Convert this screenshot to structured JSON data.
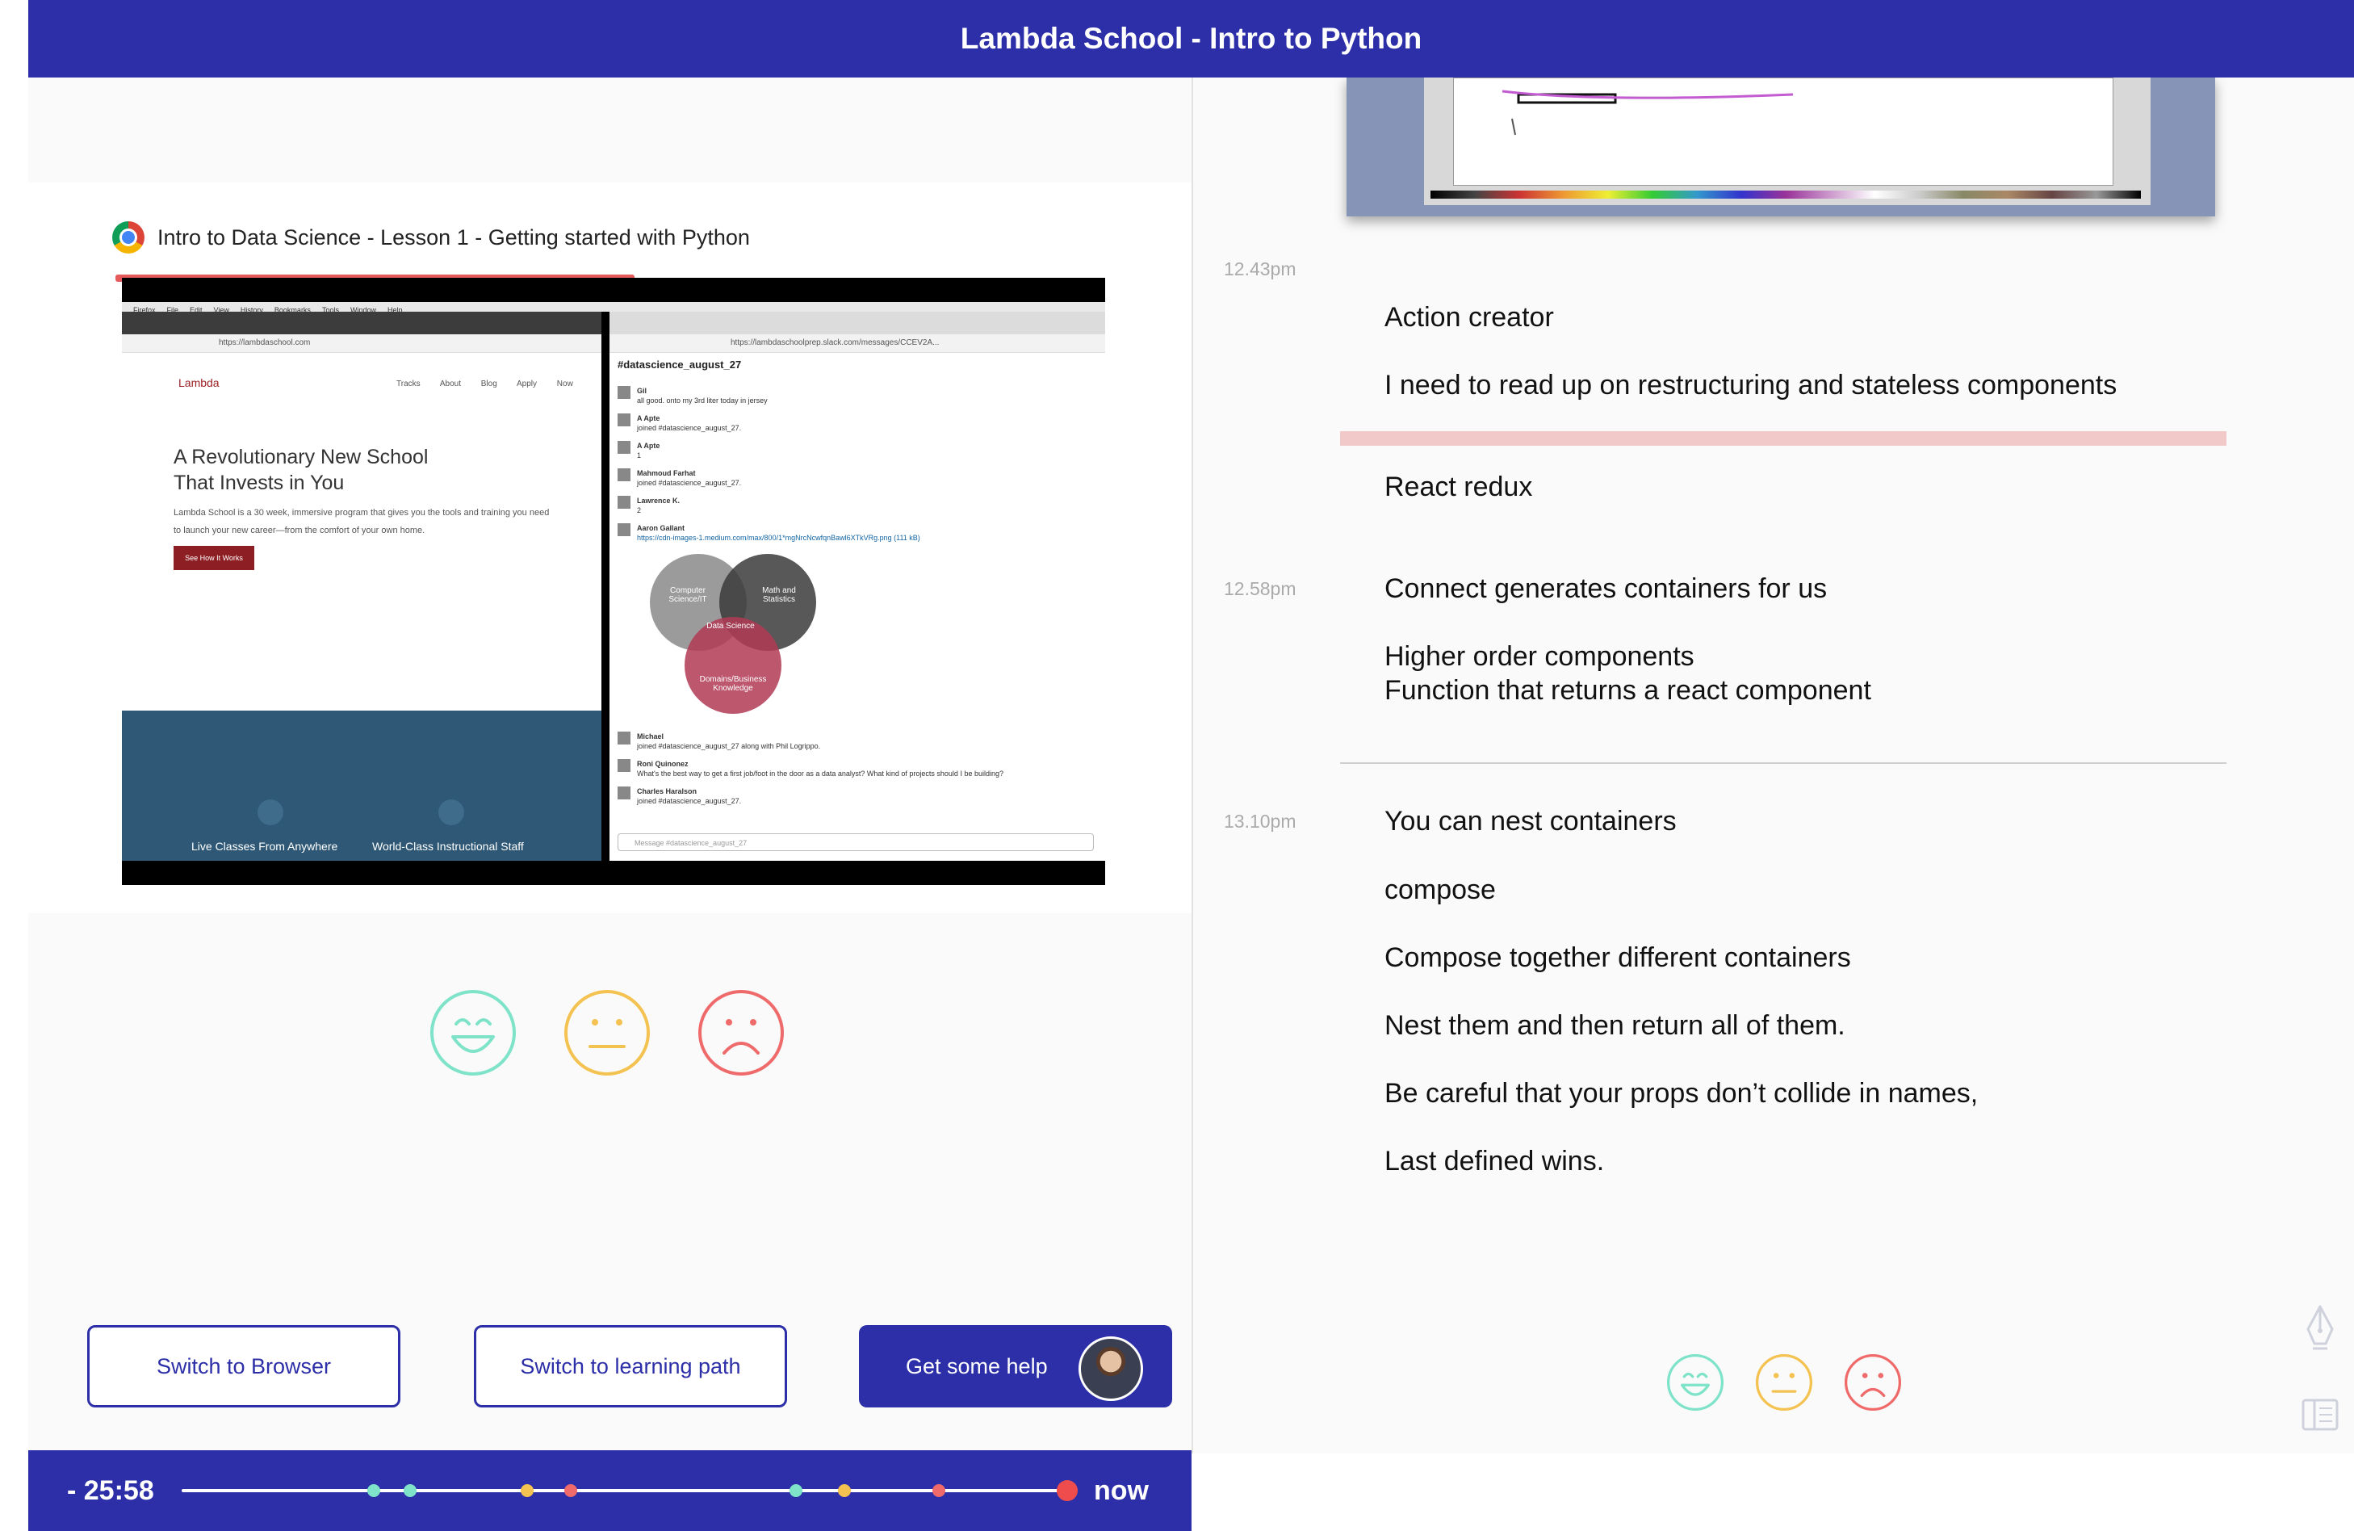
{
  "header": {
    "title": "Lambda School - Intro to Python"
  },
  "video": {
    "title": "Intro to Data Science - Lesson 1 - Getting started with Python",
    "left_pane": {
      "url": "https://lambdaschool.com",
      "logo": "Lambda",
      "nav": "Tracks About Blog Apply Now",
      "headline_1": "A Revolutionary New School",
      "headline_2": "That Invests in You",
      "body": "Lambda School is a 30 week, immersive program that gives you the tools and training you need to launch your new career—from the comfort of your own home.",
      "cta": "See How It Works",
      "feature_1": "Live Classes From Anywhere",
      "feature_2": "World-Class Instructional Staff"
    },
    "right_pane": {
      "url": "https://lambdaschoolprep.slack.com/messages/CCEV2A...",
      "channel": "#datascience_august_27",
      "messages": [
        {
          "name": "Gil",
          "text": "all good. onto my 3rd liter today in jersey"
        },
        {
          "name": "A Apte",
          "text": "joined #datascience_august_27."
        },
        {
          "name": "A Apte",
          "text": "1"
        },
        {
          "name": "Mahmoud Farhat",
          "text": "joined #datascience_august_27."
        },
        {
          "name": "Lawrence K.",
          "text": "2"
        },
        {
          "name": "Aaron Gallant",
          "text": "https://cdn-images-1.medium.com/max/800/1*mgNrcNcwfqnBawl6XTkVRg.png (111 kB)"
        },
        {
          "name": "Michael",
          "text": "joined #datascience_august_27 along with Phil Logrippo."
        },
        {
          "name": "Roni Quinonez",
          "text": "What's the best way to get a first job/foot in the door as a data analyst? What kind of projects should I be building?"
        },
        {
          "name": "Charles Haralson",
          "text": "joined #datascience_august_27."
        }
      ],
      "venn": {
        "a": "Computer Science/IT",
        "b": "Math and Statistics",
        "c": "Domains/Business Knowledge",
        "center": "Data Science"
      },
      "input_placeholder": "Message #datascience_august_27"
    }
  },
  "actions": {
    "switch_browser": "Switch to Browser",
    "switch_learning": "Switch to learning path",
    "get_help": "Get some help"
  },
  "timeline": {
    "elapsed": "- 25:58",
    "now": "now",
    "markers": [
      {
        "pos": 0.218,
        "color": "#7ee3c8"
      },
      {
        "pos": 0.259,
        "color": "#7ee3c8"
      },
      {
        "pos": 0.392,
        "color": "#f4c250"
      },
      {
        "pos": 0.441,
        "color": "#ef6a6a"
      },
      {
        "pos": 0.697,
        "color": "#7ee3c8"
      },
      {
        "pos": 0.752,
        "color": "#f4c250"
      },
      {
        "pos": 0.859,
        "color": "#ef6a6a"
      }
    ]
  },
  "notes": {
    "entries": [
      {
        "time": "12.43pm",
        "lines": [
          "Action creator",
          "I need to read up on restructuring and stateless components",
          "React redux"
        ]
      },
      {
        "time": "12.58pm",
        "lines": [
          "Connect generates containers for us",
          "Higher order components",
          "Function that returns a react component"
        ]
      },
      {
        "time": "13.10pm",
        "lines": [
          "You can nest containers",
          "compose",
          "Compose together different containers",
          "Nest them and then return all of them.",
          "Be careful that your props don’t collide in names,",
          "Last defined wins."
        ]
      }
    ]
  },
  "colors": {
    "brand": "#2c2fa8",
    "happy": "#7ee3c8",
    "neutral": "#f4c250",
    "sad": "#ef6a6a"
  },
  "icons": [
    "chrome-icon",
    "happy-face-icon",
    "neutral-face-icon",
    "sad-face-icon",
    "pen-icon",
    "sidebar-toggle-icon"
  ]
}
